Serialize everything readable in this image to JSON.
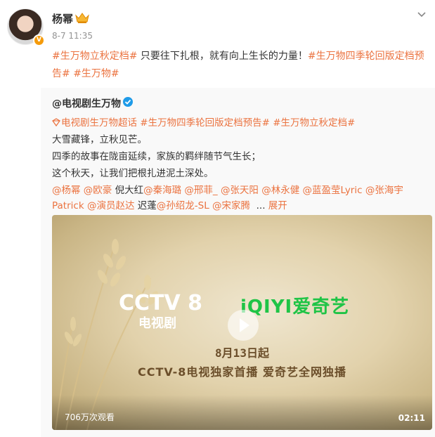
{
  "post": {
    "author": "杨幂",
    "time": "8-7 11:35",
    "text": {
      "tag1": "#生万物立秋定档#",
      "body": " 只要往下扎根，就有向上生长的力量！",
      "tag2": "#生万物四季轮回版定档预告#",
      "tag3": "#生万物#"
    }
  },
  "retweet": {
    "author": "@电视剧生万物",
    "line1": {
      "tag1": "电视剧生万物超话",
      "tag2": "#生万物四季轮回版定档预告#",
      "tag3": "#生万物立秋定档#"
    },
    "line2": "大雪藏锋，立秋见芒。",
    "line3": "四季的故事在陇亩延续，家族的羁绊随节气生长；",
    "line4": "这个秋天，让我们把根扎进泥土深处。",
    "mentions_row1": [
      "@杨幂",
      "@欧豪",
      "倪大红",
      "@秦海璐",
      "@邢菲_",
      "@张天阳",
      "@林永健",
      "@蓝盈莹Lyric",
      "@张海宇"
    ],
    "mentions_row2": [
      "Patrick",
      "@演员赵达",
      "迟蓬",
      "@孙绍龙-SL",
      "@宋家腾"
    ],
    "ellipsis": "...",
    "expand_label": "展开"
  },
  "video": {
    "cctv_text": "CCTV 8",
    "cctv_sub": "电视剧",
    "iqiyi_text": "iQIYI爱奇艺",
    "date_text": "8月13日起",
    "sub_text": "CCTV-8电视独家首播 爱奇艺全网独播",
    "views": "706万次观看",
    "duration": "02:11"
  },
  "colors": {
    "accent": "#eb7340",
    "iqiyi_green": "#1fc446"
  },
  "icons": [
    "crown-icon",
    "chevron-down-icon",
    "verified-icon",
    "supertopic-icon",
    "play-icon"
  ]
}
